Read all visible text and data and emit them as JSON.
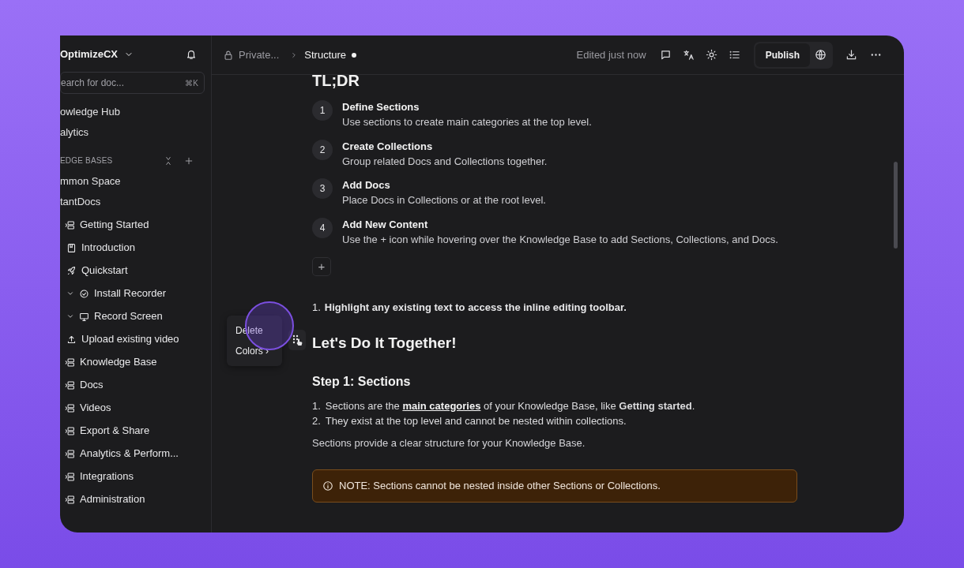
{
  "sidebar": {
    "workspace": "OptimizeCX",
    "search": {
      "placeholder": "earch for doc...",
      "shortcut": "⌘K"
    },
    "nav": [
      {
        "label": "owledge Hub"
      },
      {
        "label": "alytics"
      }
    ],
    "section_title": "EDGE BASES",
    "spaces": [
      {
        "label": "mmon Space"
      },
      {
        "label": "tantDocs"
      }
    ],
    "items": [
      {
        "label": "Getting Started",
        "kind": "section",
        "expanded": false
      },
      {
        "label": "Introduction",
        "kind": "doc",
        "expanded": false
      },
      {
        "label": "Quickstart",
        "kind": "rocket",
        "expanded": false
      },
      {
        "label": "Install Recorder",
        "kind": "check",
        "expanded": true
      },
      {
        "label": "Record Screen",
        "kind": "screen",
        "expanded": true
      },
      {
        "label": "Upload existing video",
        "kind": "upload",
        "expanded": false
      },
      {
        "label": "Knowledge Base",
        "kind": "section",
        "expanded": false
      },
      {
        "label": "Docs",
        "kind": "section",
        "expanded": false
      },
      {
        "label": "Videos",
        "kind": "section",
        "expanded": false
      },
      {
        "label": "Export & Share",
        "kind": "section",
        "expanded": false
      },
      {
        "label": "Analytics & Perform...",
        "kind": "section",
        "expanded": false
      },
      {
        "label": "Integrations",
        "kind": "section",
        "expanded": false
      },
      {
        "label": "Administration",
        "kind": "section",
        "expanded": false
      }
    ]
  },
  "topbar": {
    "breadcrumb": [
      "Private...",
      "Structure"
    ],
    "unsaved": true,
    "status": "Edited just now",
    "publish": "Publish"
  },
  "document": {
    "tldr_title": "TL;DR",
    "steps": [
      {
        "number": "1",
        "title": "Define Sections",
        "text": "Use sections to create main categories at the top level."
      },
      {
        "number": "2",
        "title": "Create Collections",
        "text": "Group related Docs and Collections together."
      },
      {
        "number": "3",
        "title": "Add Docs",
        "text": "Place Docs in Collections or at the root level."
      },
      {
        "number": "4",
        "title": "Add New Content",
        "text": "Use the + icon while hovering over the Knowledge Base to add Sections, Collections, and Docs."
      }
    ],
    "add_block": "+",
    "context_menu": [
      {
        "label": "Delete"
      },
      {
        "label": "Colors ›"
      }
    ],
    "highlight_item": {
      "number": "1.",
      "text": "Highlight any existing text to access the inline editing toolbar."
    },
    "heading": "Let's Do It Together!",
    "subheading": "Step 1: Sections",
    "list": [
      {
        "number": "1.",
        "parts": [
          {
            "text": "Sections are the ",
            "link": false
          },
          {
            "text": "main categories",
            "link": true
          },
          {
            "text": " of your Knowledge Base, like **Getting started**.",
            "link": false
          }
        ]
      },
      {
        "number": "2.",
        "parts": [
          {
            "text": "They exist at the top level and cannot be nested within collections.",
            "link": false
          }
        ]
      }
    ],
    "paragraph": "Sections provide a clear structure for your Knowledge Base.",
    "note": "NOTE: Sections cannot be nested inside other Sections or Collections."
  }
}
